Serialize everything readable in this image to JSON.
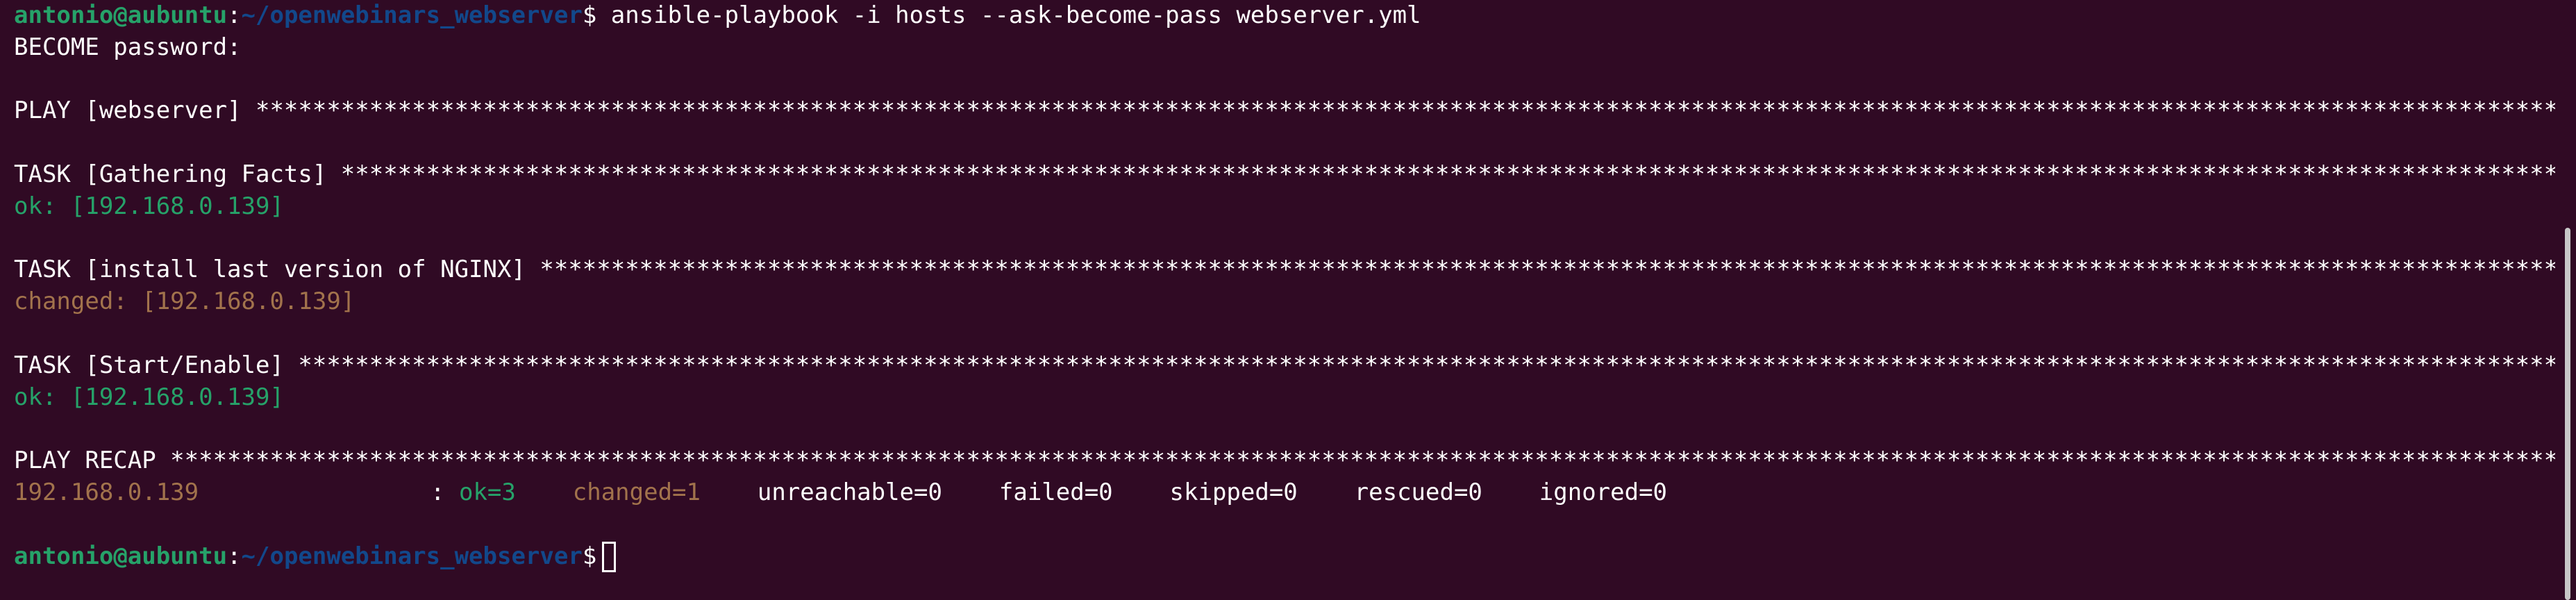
{
  "prompt": {
    "user_host": "antonio@aubuntu",
    "separator": ":",
    "path": "~/openwebinars_webserver",
    "dollar": "$"
  },
  "command": "ansible-playbook -i hosts --ask-become-pass webserver.yml",
  "become_prompt": "BECOME password:",
  "play_header": "PLAY [webserver] *************************************************************************************************************************************************************************",
  "tasks": [
    {
      "header": "TASK [Gathering Facts] *******************************************************************************************************************************************************************",
      "result": "ok: [192.168.0.139]",
      "status": "ok"
    },
    {
      "header": "TASK [install last version of NGINX] *****************************************************************************************************************************************************",
      "result": "changed: [192.168.0.139]",
      "status": "changed"
    },
    {
      "header": "TASK [Start/Enable] **********************************************************************************************************************************************************************",
      "result": "ok: [192.168.0.139]",
      "status": "ok"
    }
  ],
  "recap": {
    "header": "PLAY RECAP *******************************************************************************************************************************************************************************",
    "host": "192.168.0.139",
    "colon": ":",
    "ok": "ok=3",
    "changed": "changed=1",
    "unreachable": "unreachable=0",
    "failed": "failed=0",
    "skipped": "skipped=0",
    "rescued": "rescued=0",
    "ignored": "ignored=0"
  },
  "colors": {
    "background": "#300a24",
    "ok_green": "#26a269",
    "changed_orange": "#a2734c",
    "path_blue": "#12488b"
  }
}
